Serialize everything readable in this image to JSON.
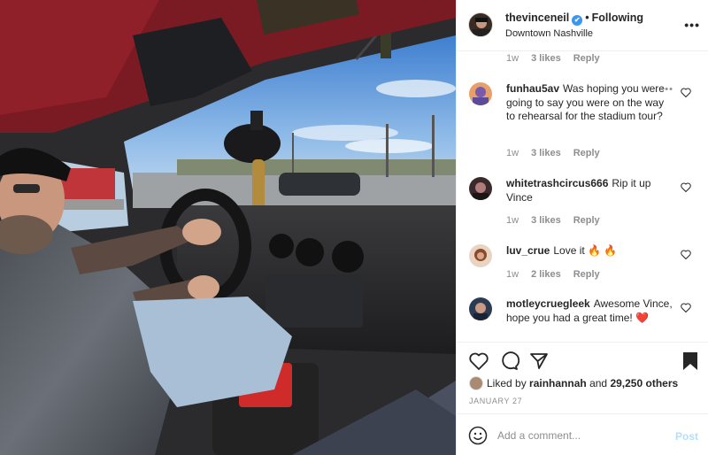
{
  "post": {
    "username": "thevinceneil",
    "verified_mark": "✔",
    "separator": "•",
    "follow_status": "Following",
    "location": "Downtown Nashville",
    "more_label": "•••",
    "image_description_icon": "car-interior-photo"
  },
  "first_comment_meta": {
    "time": "1w",
    "likes": "3 likes",
    "reply": "Reply"
  },
  "comments": [
    {
      "user": "funhau5av",
      "text": "Was hoping you were going to say you were on the way to rehearsal for the stadium tour?",
      "time": "1w",
      "likes": "3 likes",
      "reply": "Reply",
      "more": "•••"
    },
    {
      "user": "whitetrashcircus666",
      "text": "Rip it up Vince",
      "time": "1w",
      "likes": "3 likes",
      "reply": "Reply"
    },
    {
      "user": "luv_crue",
      "text": "Love it 🔥 🔥",
      "time": "1w",
      "likes": "2 likes",
      "reply": "Reply"
    },
    {
      "user": "motleycruegleek",
      "text": "Awesome Vince, hope you had a great time! ❤️",
      "time": "",
      "likes": "",
      "reply": ""
    }
  ],
  "actions": {
    "heart_icon": "heart-icon",
    "comment_icon": "comment-icon",
    "share_icon": "share-icon",
    "save_icon": "bookmark-icon"
  },
  "likes": {
    "prefix": "Liked by",
    "user": "rainhannah",
    "and": "and",
    "count": "29,250 others"
  },
  "date": "JANUARY 27",
  "add_comment": {
    "placeholder": "Add a comment...",
    "post_label": "Post"
  },
  "colors": {
    "link_blue": "#3897f0",
    "post_disabled": "#b2dffc",
    "muted": "#8e8e8e",
    "text": "#262626"
  }
}
